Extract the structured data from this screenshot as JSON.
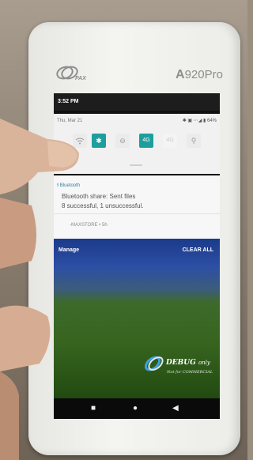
{
  "device": {
    "brand": "PAX",
    "model_prefix": "A",
    "model_suffix": "920Pro"
  },
  "status_bar": {
    "time": "3:52 PM"
  },
  "quick_settings": {
    "date": "Thu, Mar 21",
    "status_icons": "✱ ▣ ⋯◢ ▮ 64%",
    "tiles": [
      {
        "name": "wifi",
        "label": "",
        "state": "off"
      },
      {
        "name": "bluetooth",
        "label": "✱",
        "state": "on"
      },
      {
        "name": "dnd",
        "label": "⊖",
        "state": "off"
      },
      {
        "name": "4g",
        "label": "4G",
        "state": "on"
      },
      {
        "name": "lte",
        "label": "4G",
        "state": "dim"
      },
      {
        "name": "flashlight",
        "label": "⚲",
        "state": "off"
      }
    ]
  },
  "notification": {
    "app": "Bluetooth",
    "title": "Bluetooth share: Sent files",
    "text": "8 successful, 1 unsuccessful.",
    "source": "-MAXSTORE • 5h"
  },
  "actions": {
    "manage": "Manage",
    "clear_all": "CLEAR ALL"
  },
  "watermark": {
    "title": "DEBUG",
    "only": "only",
    "sub": "Not for COMMERCIAL"
  },
  "colors": {
    "accent": "#1f9e9e",
    "notif_app": "#2a7fa6"
  }
}
